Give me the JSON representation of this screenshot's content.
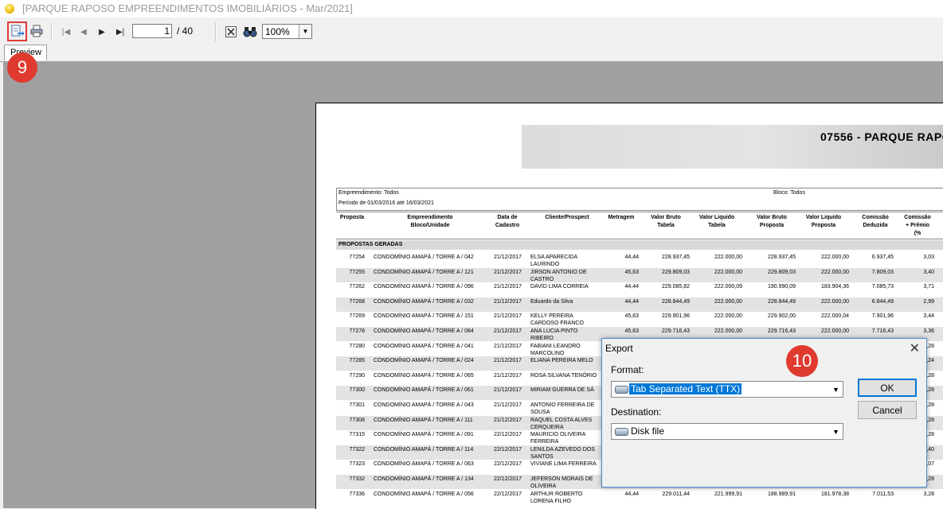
{
  "window": {
    "title": "[PARQUE RAPOSO EMPREENDIMENTOS IMOBILIÁRIOS - Mar/2021]"
  },
  "toolbar": {
    "page_current": "1",
    "page_total": "/ 40",
    "zoom": "100%",
    "icons": [
      "export-icon",
      "print-icon",
      "first-page-icon",
      "prev-page-icon",
      "next-page-icon",
      "last-page-icon",
      "close-report-icon",
      "search-icon"
    ]
  },
  "tabs": {
    "preview": "Preview"
  },
  "annotations": {
    "step_9": "9",
    "step_10": "10"
  },
  "report": {
    "title": "07556 - PARQUE RAPO",
    "filters": {
      "empreendimento": "Empreendimento: Todos",
      "periodo": "Período de 01/03/2016 até 16/03/2021",
      "bloco": "Bloco: Todos"
    },
    "columns": [
      "Proposta",
      "Empreendimento\nBloco/Unidade",
      "Data de\nCadastro",
      "Cliente/Prospect",
      "Metragem",
      "Valor Bruto\nTabela",
      "Valor Liquido\nTabela",
      "Valor Bruto\nProposta",
      "Valor Liquido\nProposta",
      "Comissão\nDeduzida",
      "Comissão\n+ Prêmio\n(%"
    ],
    "group_label": "PROPOSTAS GERADAS",
    "rows": [
      {
        "proposta": "77254",
        "empreend": "CONDOMÍNIO AMAPÁ / TORRE A / 042",
        "data": "21/12/2017",
        "cliente": "ELSA APARECIDA LAURINDO",
        "metragem": "44,44",
        "vbt": "228.937,45",
        "vlt": "222.000,00",
        "vbp": "228.937,45",
        "vlp": "222.000,00",
        "comded": "6.937,45",
        "compre": "3,03"
      },
      {
        "proposta": "77255",
        "empreend": "CONDOMÍNIO AMAPÁ / TORRE A / 121",
        "data": "21/12/2017",
        "cliente": "JIRSON ANTONIO DE CASTRO",
        "metragem": "45,63",
        "vbt": "229.809,03",
        "vlt": "222.000,00",
        "vbp": "229.809,03",
        "vlp": "222.000,00",
        "comded": "7.809,03",
        "compre": "3,40"
      },
      {
        "proposta": "77262",
        "empreend": "CONDOMÍNIO AMAPÁ / TORRE A / 096",
        "data": "21/12/2017",
        "cliente": "DAVID LIMA CORREIA",
        "metragem": "44,44",
        "vbt": "229.085,82",
        "vlt": "222.000,09",
        "vbp": "190.990,09",
        "vlp": "183.904,36",
        "comded": "7.085,73",
        "compre": "3,71"
      },
      {
        "proposta": "77268",
        "empreend": "CONDOMÍNIO AMAPÁ / TORRE A / 032",
        "data": "21/12/2017",
        "cliente": "Eduardo da Silva",
        "metragem": "44,44",
        "vbt": "228.844,49",
        "vlt": "222.000,00",
        "vbp": "228.844,49",
        "vlp": "222.000,00",
        "comded": "6.844,49",
        "compre": "2,99"
      },
      {
        "proposta": "77269",
        "empreend": "CONDOMÍNIO AMAPÁ / TORRE A / 151",
        "data": "21/12/2017",
        "cliente": "KELLY PEREIRA CARDOSO FRANCO",
        "metragem": "45,63",
        "vbt": "229.901,96",
        "vlt": "222.000,00",
        "vbp": "229.902,00",
        "vlp": "222.000,04",
        "comded": "7.901,96",
        "compre": "3,44"
      },
      {
        "proposta": "77278",
        "empreend": "CONDOMÍNIO AMAPÁ / TORRE A / 084",
        "data": "21/12/2017",
        "cliente": "ANA LUCIA PINTO RIBEIRO",
        "metragem": "45,63",
        "vbt": "229.716,43",
        "vlt": "222.000,00",
        "vbp": "229.716,43",
        "vlp": "222.000,00",
        "comded": "7.716,43",
        "compre": "3,36"
      },
      {
        "proposta": "77280",
        "empreend": "CONDOMÍNIO AMAPÁ / TORRE A / 041",
        "data": "21/12/2017",
        "cliente": "FABIANI LEANDRO MARCOLINO",
        "metragem": "",
        "vbt": "",
        "vlt": "",
        "vbp": "",
        "vlp": "",
        "comded": "",
        "compre": "3,28"
      },
      {
        "proposta": "77285",
        "empreend": "CONDOMÍNIO AMAPÁ / TORRE A / 024",
        "data": "21/12/2017",
        "cliente": "ELIANA PEREIRA MELO",
        "metragem": "",
        "vbt": "",
        "vlt": "",
        "vbp": "",
        "vlp": "",
        "comded": "",
        "compre": "3,24"
      },
      {
        "proposta": "77290",
        "empreend": "CONDOMÍNIO AMAPÁ / TORRE A / 065",
        "data": "21/12/2017",
        "cliente": "ROSA SILVANA TENÓRIO",
        "metragem": "",
        "vbt": "",
        "vlt": "",
        "vbp": "",
        "vlp": "",
        "comded": "",
        "compre": "3,28"
      },
      {
        "proposta": "77300",
        "empreend": "CONDOMÍNIO AMAPÁ / TORRE A / 061",
        "data": "21/12/2017",
        "cliente": "MIRIAM GUERRA DE SÁ",
        "metragem": "",
        "vbt": "",
        "vlt": "",
        "vbp": "",
        "vlp": "",
        "comded": "",
        "compre": "3,28"
      },
      {
        "proposta": "77301",
        "empreend": "CONDOMÍNIO AMAPÁ / TORRE A / 043",
        "data": "21/12/2017",
        "cliente": "ANTONIO FERREIRA DE SOUSA",
        "metragem": "",
        "vbt": "",
        "vlt": "",
        "vbp": "",
        "vlp": "",
        "comded": "",
        "compre": "3,28"
      },
      {
        "proposta": "77308",
        "empreend": "CONDOMÍNIO AMAPÁ / TORRE A / 111",
        "data": "21/12/2017",
        "cliente": "RAQUEL COSTA ALVES CERQUEIRA",
        "metragem": "",
        "vbt": "",
        "vlt": "",
        "vbp": "",
        "vlp": "",
        "comded": "",
        "compre": "3,28"
      },
      {
        "proposta": "77315",
        "empreend": "CONDOMÍNIO AMAPÁ / TORRE A / 091",
        "data": "22/12/2017",
        "cliente": "MAURICIO OLIVEIRA FERREIRA",
        "metragem": "",
        "vbt": "",
        "vlt": "",
        "vbp": "",
        "vlp": "",
        "comded": "",
        "compre": "3,28"
      },
      {
        "proposta": "77322",
        "empreend": "CONDOMÍNIO AMAPÁ / TORRE A / 114",
        "data": "22/12/2017",
        "cliente": "LENILDA AZEVEDO DOS SANTOS",
        "metragem": "",
        "vbt": "",
        "vlt": "",
        "vbp": "",
        "vlp": "",
        "comded": "",
        "compre": "3,40"
      },
      {
        "proposta": "77323",
        "empreend": "CONDOMÍNIO AMAPÁ / TORRE A / 063",
        "data": "22/12/2017",
        "cliente": "VIVIANE LIMA FERREIRA",
        "metragem": "",
        "vbt": "",
        "vlt": "",
        "vbp": "",
        "vlp": "",
        "comded": "",
        "compre": "3,07"
      },
      {
        "proposta": "77332",
        "empreend": "CONDOMÍNIO AMAPÁ / TORRE A / 134",
        "data": "22/12/2017",
        "cliente": "JEFERSON MORAIS DE OLIVEIRA",
        "metragem": "",
        "vbt": "",
        "vlt": "",
        "vbp": "",
        "vlp": "",
        "comded": "",
        "compre": "3,28"
      },
      {
        "proposta": "77336",
        "empreend": "CONDOMÍNIO AMAPÁ / TORRE A / 056",
        "data": "22/12/2017",
        "cliente": "ARTHUR ROBERTO LORENA FILHO",
        "metragem": "44,44",
        "vbt": "229.011,44",
        "vlt": "221.999,91",
        "vbp": "188.989,91",
        "vlp": "181.978,38",
        "comded": "7.011,53",
        "compre": "3,28"
      }
    ]
  },
  "dialog": {
    "title": "Export",
    "close": "✕",
    "format_label": "Format:",
    "format_value": "Tab Separated Text (TTX)",
    "destination_label": "Destination:",
    "destination_value": "Disk file",
    "ok": "OK",
    "cancel": "Cancel"
  },
  "colors": {
    "accent": "#0078d7",
    "badge": "#e03a2f",
    "viewer_bg": "#a0a0a0"
  }
}
